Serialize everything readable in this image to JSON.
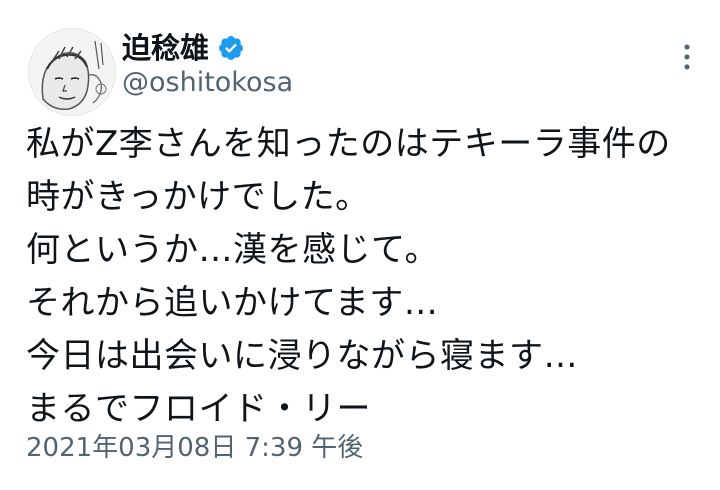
{
  "author": {
    "display_name": "迫稔雄",
    "handle": "@oshitokosa",
    "avatar_icon": "avatar-illustration-icon",
    "verified_icon": "verified-badge-icon"
  },
  "menu_icon": "more-options-icon",
  "tweet": {
    "lines": [
      "私がZ李さんを知ったのはテキーラ事件の",
      "時がきっかけでした。",
      "何というか…漢を感じて。",
      "それから追いかけてます…",
      "今日は出会いに浸りながら寝ます…",
      "まるでフロイド・リー"
    ],
    "timestamp": "2021年03月08日 7:39 午後"
  },
  "colors": {
    "text": "#0f1419",
    "secondary": "#536471",
    "verified": "#1d9bf0"
  }
}
